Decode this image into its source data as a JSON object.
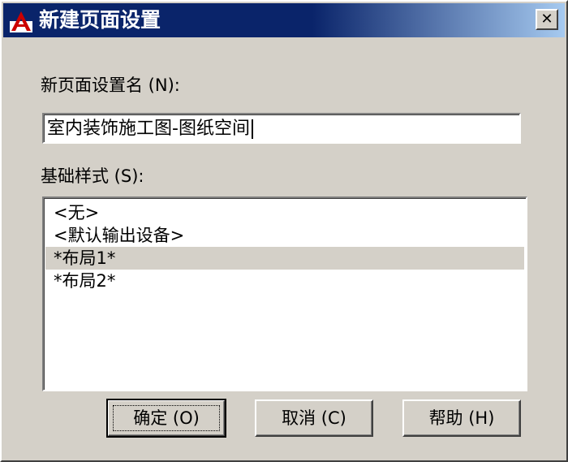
{
  "window": {
    "title": "新建页面设置",
    "close_symbol": "✕"
  },
  "name_field": {
    "label": "新页面设置名 (N):",
    "value": "室内装饰施工图-图纸空间"
  },
  "base_style": {
    "label": "基础样式 (S):",
    "items": [
      {
        "label": "<无>",
        "selected": false
      },
      {
        "label": "<默认输出设备>",
        "selected": false
      },
      {
        "label": "*布局1*",
        "selected": true
      },
      {
        "label": "*布局2*",
        "selected": false
      }
    ]
  },
  "buttons": {
    "ok_label": "确定 (O)",
    "cancel_label": "取消 (C)",
    "help_label": "帮助 (H)"
  },
  "colors": {
    "titlebar": "#0a246a",
    "dialog_bg": "#d4d0c8",
    "app_icon": "#cc0000"
  },
  "icons": {
    "app": "autocad-logo-icon",
    "close": "close-icon"
  }
}
